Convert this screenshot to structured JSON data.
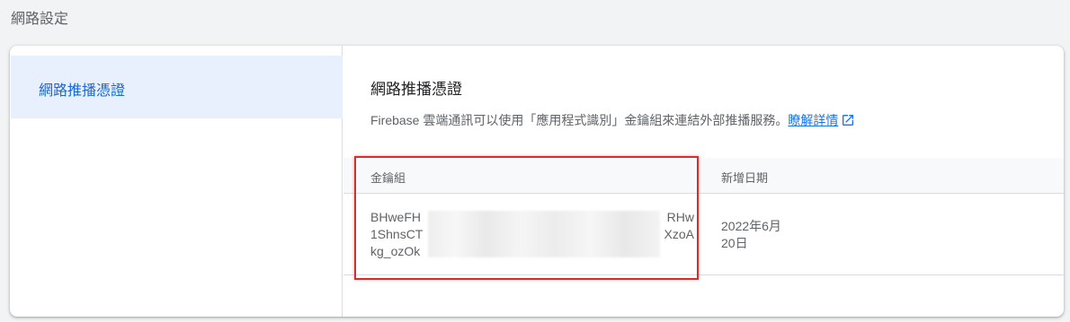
{
  "page": {
    "heading": "網路設定"
  },
  "sidebar": {
    "items": [
      {
        "label": "網路推播憑證",
        "selected": true
      }
    ]
  },
  "section": {
    "title": "網路推播憑證",
    "description": "Firebase 雲端通訊可以使用「應用程式識別」金鑰組來連結外部推播服務。",
    "learn_more": "瞭解詳情",
    "learn_more_icon": "open-in-new-icon"
  },
  "table": {
    "headers": {
      "key_pair": "金鑰組",
      "date_added": "新增日期"
    },
    "rows": [
      {
        "key_line1_start": "BHweFH",
        "key_line1_end": "RHw",
        "key_line2_start": "1ShnsCT",
        "key_line2_end": "XzoA",
        "key_line3": "kg_ozOk",
        "date_line1": "2022年6月",
        "date_line2": "20日"
      }
    ]
  },
  "colors": {
    "accent": "#1a73e8",
    "selected_bg": "#e8f0fe",
    "highlight": "#d32f2f"
  }
}
